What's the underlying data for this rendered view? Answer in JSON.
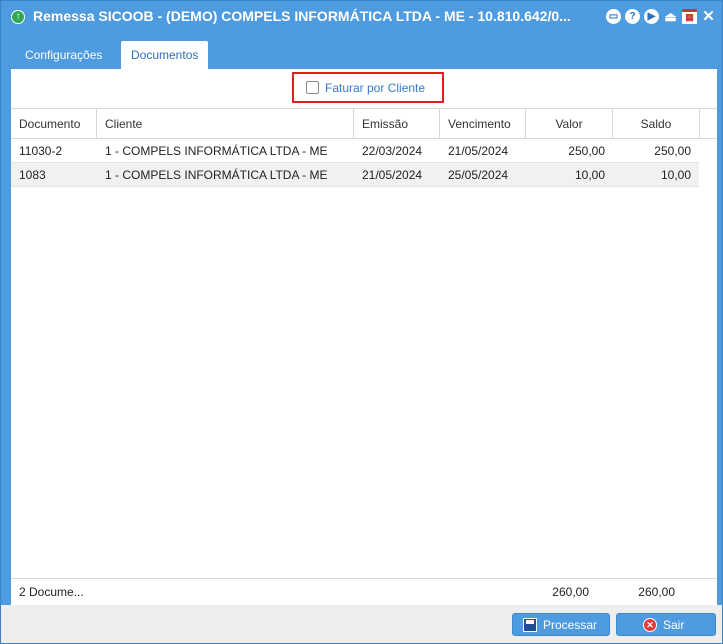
{
  "window": {
    "title": "Remessa SICOOB - (DEMO) COMPELS INFORMÁTICA LTDA - ME - 10.810.642/0...",
    "title_icon": "green-up-arrow-icon",
    "toolbar_icons": [
      "minimize-icon",
      "help-icon",
      "play-icon",
      "upload-icon",
      "calendar-icon",
      "close-icon"
    ],
    "accent_color": "#4e9be0"
  },
  "tabs": [
    {
      "label": "Configurações",
      "active": false
    },
    {
      "label": "Documentos",
      "active": true
    }
  ],
  "filter": {
    "checkbox_label": "Faturar por Cliente",
    "checked": false,
    "highlight_color": "#e11d1d"
  },
  "grid": {
    "columns": [
      "Documento",
      "Cliente",
      "Emissão",
      "Vencimento",
      "Valor",
      "Saldo"
    ],
    "rows": [
      {
        "documento": "11030-2",
        "cliente": "1 - COMPELS INFORMÁTICA LTDA - ME",
        "emissao": "22/03/2024",
        "vencimento": "21/05/2024",
        "valor": "250,00",
        "saldo": "250,00"
      },
      {
        "documento": "1083",
        "cliente": "1 - COMPELS INFORMÁTICA LTDA - ME",
        "emissao": "21/05/2024",
        "vencimento": "25/05/2024",
        "valor": "10,00",
        "saldo": "10,00"
      }
    ],
    "footer": {
      "count": "2 Docume...",
      "valor_total": "260,00",
      "saldo_total": "260,00"
    }
  },
  "buttons": {
    "processar": "Processar",
    "sair": "Sair"
  }
}
